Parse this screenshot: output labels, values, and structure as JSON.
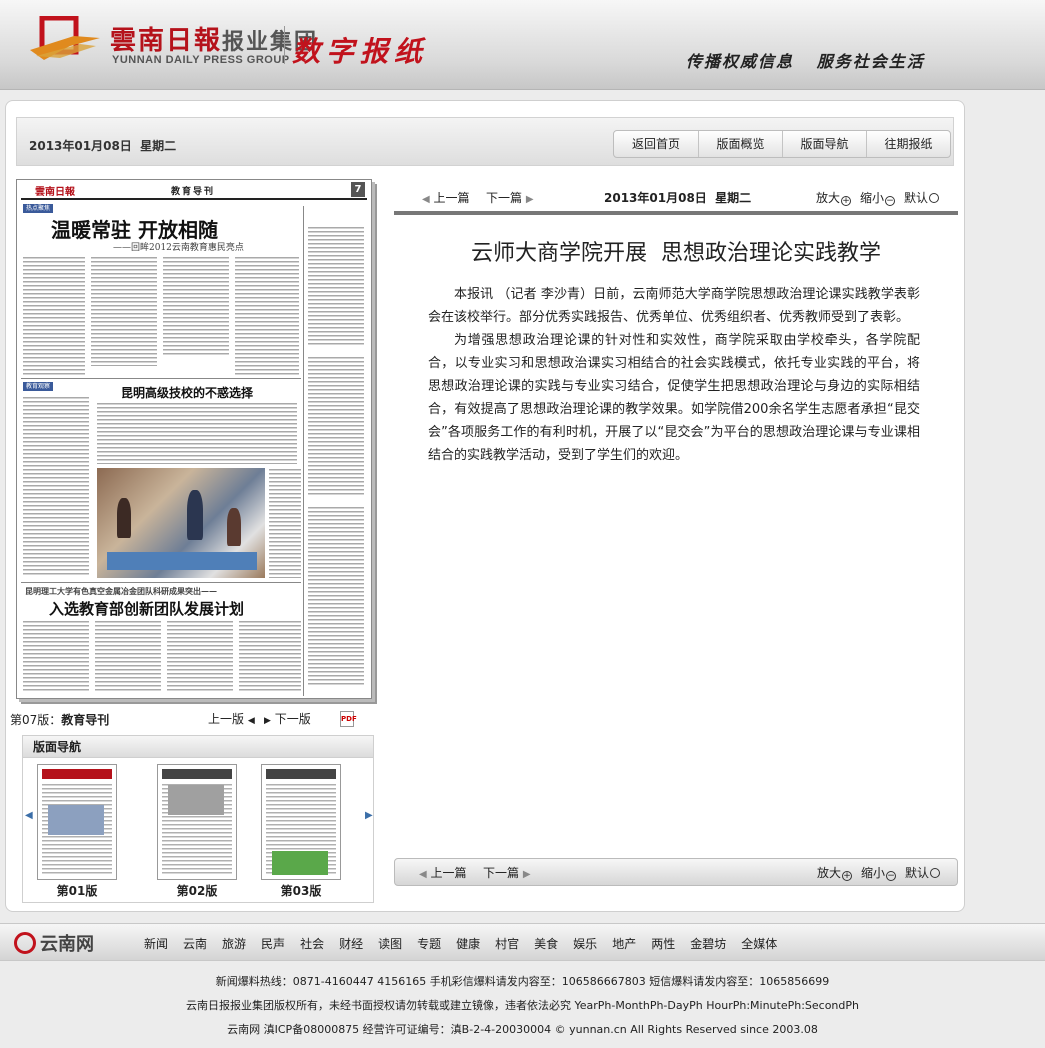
{
  "header": {
    "logo_cn": "雲南日報",
    "logo_group": "报业集团",
    "logo_en": "YUNNAN DAILY PRESS GROUP",
    "site_name": "数字报纸",
    "slogan": "传播权威信息   服务社会生活"
  },
  "topbar": {
    "date": "2013年01月08日  星期二",
    "nav": [
      "返回首页",
      "版面概览",
      "版面导航",
      "往期报纸"
    ]
  },
  "newspaper": {
    "masthead": "雲南日報",
    "section": "教育导刊",
    "page_no": "7",
    "tag1": "热点聚焦",
    "headline1": "温暖常驻  开放相随",
    "subhead1": "——回眸2012云南教育惠民亮点",
    "headline2": "昆明高级技校的不惑选择",
    "kicker3": "昆明理工大学有色真空金属冶金团队科研成果突出——",
    "headline3": "入选教育部创新团队发展计划",
    "tag2": "教育观察"
  },
  "page_info": {
    "label_prefix": "第07版：",
    "label_section": "教育导刊",
    "prev": "上一版",
    "next": "下一版",
    "pdf_icon": "PDF"
  },
  "page_nav": {
    "title": "版面导航",
    "items": [
      {
        "label": "第01版"
      },
      {
        "label": "第02版"
      },
      {
        "label": "第03版"
      }
    ]
  },
  "article": {
    "prev": "上一篇",
    "next": "下一篇",
    "date": "2013年01月08日  星期二",
    "zoom_in": "放大",
    "zoom_out": "缩小",
    "zoom_default": "默认",
    "title": "云师大商学院开展  思想政治理论实践教学",
    "paragraphs": [
      "本报讯 （记者 李沙青）日前，云南师范大学商学院思想政治理论课实践教学表彰会在该校举行。部分优秀实践报告、优秀单位、优秀组织者、优秀教师受到了表彰。",
      "为增强思想政治理论课的针对性和实效性，商学院采取由学校牵头，各学院配合，以专业实习和思想政治课实习相结合的社会实践模式，依托专业实践的平台，将思想政治理论课的实践与专业实习结合，促使学生把思想政治理论与身边的实际相结合，有效提高了思想政治理论课的教学效果。如学院借200余名学生志愿者承担“昆交会”各项服务工作的有利时机，开展了以“昆交会”为平台的思想政治理论课与专业课相结合的实践教学活动，受到了学生们的欢迎。"
    ]
  },
  "bottom_nav": {
    "logo": "云南网",
    "links": [
      "新闻",
      "云南",
      "旅游",
      "民声",
      "社会",
      "财经",
      "读图",
      "专题",
      "健康",
      "村官",
      "美食",
      "娱乐",
      "地产",
      "两性",
      "金碧坊",
      "全媒体"
    ]
  },
  "footer": {
    "line1": "新闻爆料热线：0871-4160447 4156165 手机彩信爆料请发内容至：106586667803 短信爆料请发内容至：1065856699",
    "line2": "云南日报报业集团版权所有，未经书面授权请勿转载或建立镜像，违者依法必究 YearPh-MonthPh-DayPh HourPh:MinutePh:SecondPh",
    "line3": "云南网  滇ICP备08000875  经营许可证编号：滇B-2-4-20030004 © yunnan.cn All Rights Reserved since 2003.08"
  },
  "colors": {
    "brand_red": "#c1121c",
    "rule_gray": "#777777"
  }
}
